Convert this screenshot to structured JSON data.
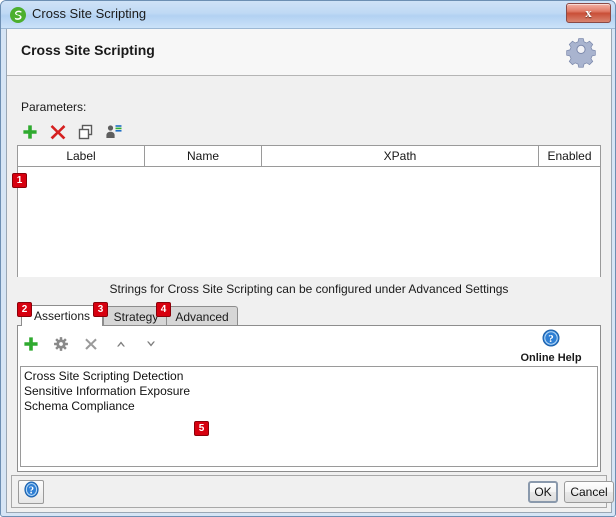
{
  "window": {
    "title": "Cross Site Scripting",
    "app_icon": "soapui-logo-icon",
    "close_label": "x"
  },
  "header": {
    "title": "Cross Site Scripting",
    "gear_icon": "gear-icon"
  },
  "parameters": {
    "label": "Parameters:",
    "toolbar": [
      {
        "name": "add-parameter-button",
        "icon": "plus-icon",
        "glyph": "+"
      },
      {
        "name": "remove-parameter-button",
        "icon": "delete-x-icon",
        "glyph": "✕"
      },
      {
        "name": "copy-parameter-button",
        "icon": "copy-icon",
        "glyph": "⧉"
      },
      {
        "name": "extract-parameters-button",
        "icon": "person-list-icon",
        "glyph": ""
      }
    ],
    "columns": [
      "Label",
      "Name",
      "XPath",
      "Enabled"
    ],
    "rows": []
  },
  "hint": "Strings for Cross Site Scripting can be configured under Advanced Settings",
  "tabs": [
    {
      "label": "Assertions",
      "active": true
    },
    {
      "label": "Strategy",
      "active": false
    },
    {
      "label": "Advanced",
      "active": false
    }
  ],
  "assertions": {
    "toolbar": [
      {
        "name": "add-assertion-button",
        "icon": "plus-icon",
        "glyph": "+"
      },
      {
        "name": "configure-assertion-button",
        "icon": "gear-icon",
        "glyph": ""
      },
      {
        "name": "remove-assertion-button",
        "icon": "x-icon",
        "glyph": "✕"
      },
      {
        "name": "move-assertion-up-button",
        "icon": "chevron-up-icon",
        "glyph": "⌃"
      },
      {
        "name": "move-assertion-down-button",
        "icon": "chevron-down-icon",
        "glyph": "⌄"
      }
    ],
    "online_help": {
      "label": "Online Help",
      "icon": "help-circle-icon"
    },
    "items": [
      "Cross Site Scripting Detection",
      "Sensitive Information Exposure",
      "Schema Compliance"
    ]
  },
  "footer": {
    "help_icon": "help-circle-icon",
    "ok_label": "OK",
    "cancel_label": "Cancel"
  },
  "badges": [
    {
      "id": 1,
      "text": "1"
    },
    {
      "id": 2,
      "text": "2"
    },
    {
      "id": 3,
      "text": "3"
    },
    {
      "id": 4,
      "text": "4"
    },
    {
      "id": 5,
      "text": "5"
    }
  ],
  "colors": {
    "badge_red": "#d7000f",
    "title_blue": "#bfd9f4",
    "accent_green": "#3fa535",
    "close_red": "#c94f38"
  }
}
